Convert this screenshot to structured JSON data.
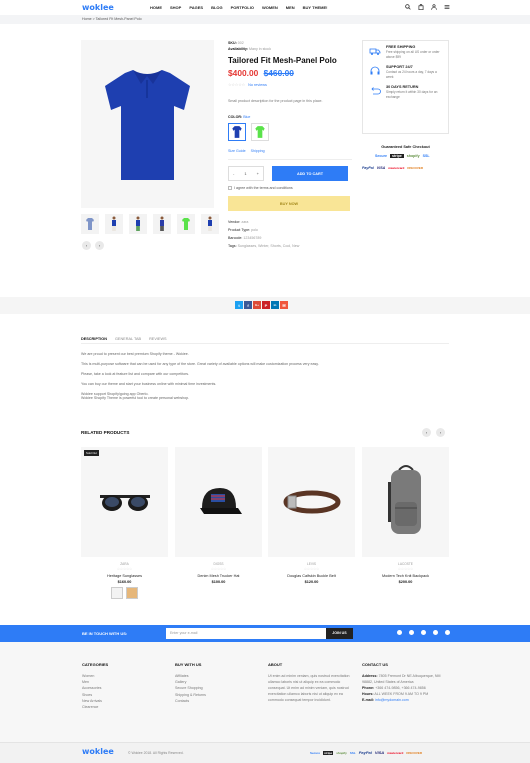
{
  "header": {
    "logo": "woklee",
    "nav": [
      "HOME",
      "SHOP",
      "PAGES",
      "BLOG",
      "PORTFOLIO",
      "WOMEN",
      "MEN",
      "BUY THEME!"
    ],
    "icons": [
      "search-icon",
      "bag-icon",
      "user-icon",
      "menu-icon"
    ]
  },
  "breadcrumb": {
    "home": "Home",
    "separator": ">",
    "current": "Tailored Fit Mesh-Panel Polo"
  },
  "product": {
    "sku_label": "SKU:",
    "sku_value": "002",
    "avail_label": "Availability:",
    "avail_value": "Many in stock",
    "title": "Tailored Fit Mesh-Panel Polo",
    "price_new": "$400.00",
    "price_old": "$460.00",
    "stars": "☆☆☆☆☆",
    "reviews": "No reviews",
    "description": "Small product description for the product page in this place.",
    "color_label": "COLOR:",
    "color_value": "Blue",
    "size_guide": "Size Guide",
    "shipping": "Shipping",
    "qty_minus": "-",
    "qty_value": "1",
    "qty_plus": "+",
    "add_to_cart": "ADD TO CART",
    "agree_text": "I agree with the terms and conditions",
    "buy_now": "BUY NOW",
    "vendor_label": "Vendor:",
    "vendor_value": "zara",
    "type_label": "Product Type:",
    "type_value": "polo",
    "barcode_label": "Barcode:",
    "barcode_value": "123456789",
    "tags_label": "Tags:",
    "tags_value": "Sunglasses, Winter, Shorts, Cool, New",
    "main_color": "#1e3fb0",
    "swatch_colors": [
      "#1e3fb0",
      "#5ae24a"
    ],
    "thumb_colors": [
      "#7f95c8",
      "#1e3fb0",
      "#1e3fb0",
      "#2b3da8",
      "#5ae24a",
      "#1e3fb0"
    ]
  },
  "features": [
    {
      "icon": "truck-icon",
      "title": "FREE SHIPPING",
      "desc": "Free shipping on all US order or order above $99"
    },
    {
      "icon": "headset-icon",
      "title": "SUPPORT 24/7",
      "desc": "Contact us 24 hours a day, 7 days a week"
    },
    {
      "icon": "return-icon",
      "title": "30 DAYS RETURN",
      "desc": "Simply return it within 30 days for an exchange"
    }
  ],
  "checkout": {
    "title": "Guaranteed Safe Checkout",
    "row1": [
      "Secure",
      "stripe",
      "shopify",
      "SSL"
    ],
    "row2": [
      "PayPal",
      "VISA",
      "mastercard",
      "DISCOVER"
    ]
  },
  "share": [
    "t",
    "f",
    "G+",
    "P",
    "in",
    "✉"
  ],
  "tabs": [
    "DESCRIPTION",
    "GENERAL TAB",
    "REVIEWS"
  ],
  "description_paragraphs": [
    "We are proud to present our best premium Shopify theme - Wokiee.",
    "This is multi-purpose software that can be used for any type of the store. Great variety of available options will make customization process very easy.",
    "Please, take a look at feature list and compare with our competitors.",
    "You can buy our theme and start your business online with minimal time investments.",
    "Wokiee support Shopify/going app Oberlo.\nWokiee Shopify Theme is powerful tool to create personal webshop."
  ],
  "related": {
    "title": "RELATED PRODUCTS",
    "items": [
      {
        "badge": "Sold Out",
        "vendor": "ZARA",
        "stars": "☆☆☆☆☆",
        "name": "Heritage Sunglasses",
        "price": "$160.00",
        "icon": "sunglasses-icon"
      },
      {
        "badge": "",
        "vendor": "DIOSS",
        "stars": "☆☆☆☆☆",
        "name": "Denim Mesh Trucker Hat",
        "price": "$100.00",
        "icon": "cap-icon"
      },
      {
        "badge": "",
        "vendor": "LEVIS",
        "stars": "☆☆☆☆☆",
        "name": "Douglas Calfskin Buckle Belt",
        "price": "$120.00",
        "icon": "belt-icon"
      },
      {
        "badge": "",
        "vendor": "LACOSTE",
        "stars": "☆☆☆☆☆",
        "name": "Modern Tech Knit Backpack",
        "price": "$200.00",
        "icon": "backpack-icon"
      }
    ]
  },
  "newsletter": {
    "title": "BE IN TOUCH WITH US:",
    "placeholder": "Enter your e-mail",
    "button": "JOIN US",
    "social": [
      "facebook-icon",
      "twitter-icon",
      "google-icon",
      "pinterest-icon",
      "instagram-icon"
    ]
  },
  "footer": {
    "categories": {
      "title": "CATEGORIES",
      "items": [
        "Women",
        "Men",
        "Accessories",
        "Shoes",
        "New Arrivals",
        "Clearence"
      ]
    },
    "buy": {
      "title": "BUY WITH US",
      "items": [
        "Affiliates",
        "Gallery",
        "Secure Shopping",
        "Shipping & Returns",
        "Contacts"
      ]
    },
    "about": {
      "title": "ABOUT",
      "text": "Ut enim ad minim veniam, quis nostrud exercitation ullamco laboris nisi ut aliquip ex ea commodo consequat. Ut enim ad minim veniam, quis nostrud exercitation ullamco laboris nisi ut aliquip ex ea commodo consequat tempor incididunt."
    },
    "contact": {
      "title": "CONTACT US",
      "address_label": "Address:",
      "address": "7805 Fremont Dr NE Albuquerque, NM 98882, United States of America",
      "phone_label": "Phone:",
      "phone": "+366 474-9856, +366 474-9856",
      "hours_label": "Hours:",
      "hours": "ALL WEEK FROM 9 AM TO 9 PM",
      "email_label": "E-mail:",
      "email": "info@mydomain.com"
    },
    "logo": "woklee",
    "copyright": "© Wokiee 2018. All Rights Reserved.",
    "payments": [
      "Secure",
      "stripe",
      "shopify",
      "SSL",
      "PayPal",
      "VISA",
      "mastercard",
      "DISCOVER"
    ]
  },
  "colors": {
    "accent": "#2e7cf6",
    "sale": "#e53935",
    "buy_now": "#f9e596"
  }
}
